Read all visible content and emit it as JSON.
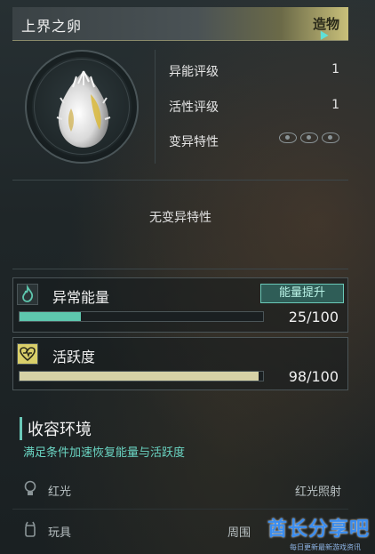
{
  "header": {
    "title": "上界之卵",
    "badge": "造物"
  },
  "stats": [
    {
      "label": "异能评级",
      "value": "1"
    },
    {
      "label": "活性评级",
      "value": "1"
    },
    {
      "label": "变异特性",
      "value": ""
    }
  ],
  "mutation_text": "无变异特性",
  "energy": {
    "label": "异常能量",
    "button": "能量提升",
    "value": "25/100",
    "fill": 0.25,
    "color": "#5ec7ae"
  },
  "activity": {
    "label": "活跃度",
    "value": "98/100",
    "fill": 0.98,
    "color": "#d6d2a6"
  },
  "environment": {
    "title": "收容环境",
    "subtitle": "满足条件加速恢复能量与活跃度",
    "rows": [
      {
        "name": "红光",
        "value": "红光照射",
        "icon": "bulb-icon"
      },
      {
        "name": "玩具",
        "value": "周围",
        "icon": "toy-icon"
      }
    ]
  },
  "watermark": {
    "text": "酋长分享吧",
    "sub": "每日更新最新游戏资讯"
  }
}
